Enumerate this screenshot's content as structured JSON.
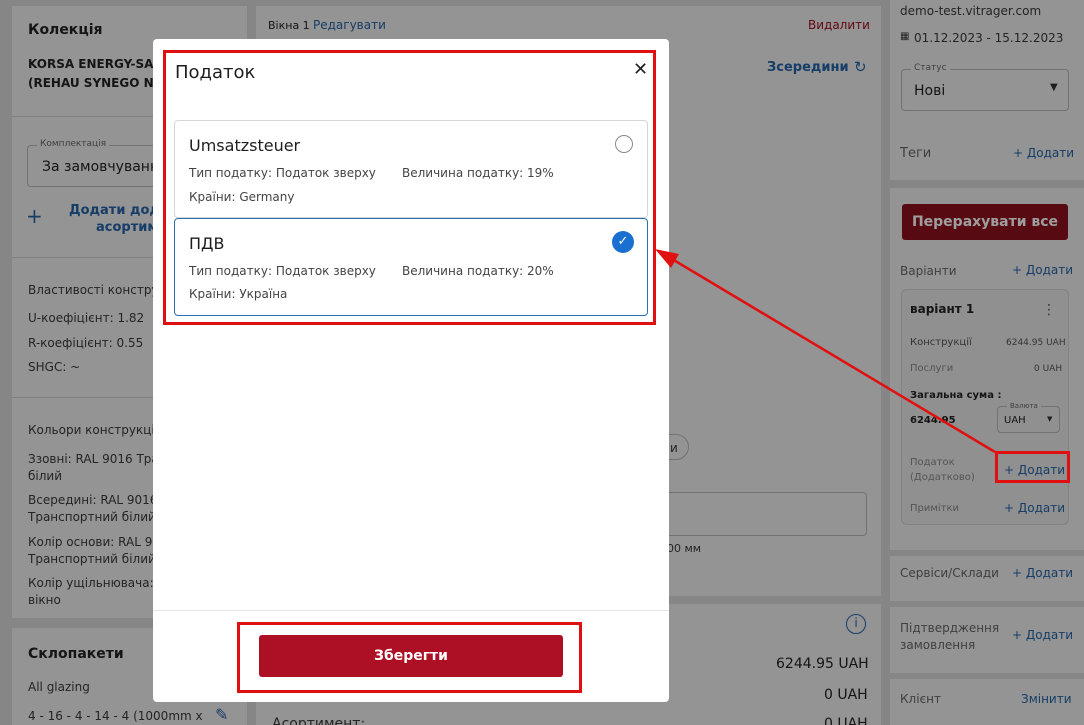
{
  "left": {
    "collection_title": "Колекція",
    "collection_line1": "KORSA ENERGY-SA",
    "collection_line2": "(REHAU SYNEGO N",
    "kit_label": "Комплектація",
    "kit_value": "За замовчуванн",
    "add_line1": "Додати дод",
    "add_line2": "асортим",
    "props_title": "Властивості констру",
    "u_coef": "U-коефіцієнт: 1.82",
    "r_coef": "R-коефіцієнт: 0.55",
    "shgc": "SHGC: ~",
    "colors_title": "Кольори конструкції",
    "c1a": "Ззовні: RAL 9016 Тран",
    "c1b": "білий",
    "c2a": "Всередині: RAL 9016",
    "c2b": "Транспортний білий",
    "c3a": "Колір основи: RAL 90",
    "c3b": "Транспортний білий",
    "c4a": "Колір ущільнювача: R",
    "c4b": "вікно",
    "glazing_title": "Склопакети",
    "glazing_sub": "All glazing",
    "glazing_spec": "4 - 16 - 4 - 14 - 4 (1000mm x"
  },
  "center": {
    "window_label": "Вікна 1",
    "edit_link": "Редагувати",
    "delete_link": "Видалити",
    "inside_label": "Зсередини",
    "dim_fragment": "00 мм",
    "chip_fragment": "и",
    "totals": [
      "6244.95 UAH",
      "0 UAH",
      "0 UAH"
    ],
    "assortment_label": "Асортимент:"
  },
  "right": {
    "domain": "demo-test.vitrager.com",
    "dates": "01.12.2023 - 15.12.2023",
    "status_label": "Статус",
    "status_value": "Нові",
    "tags_label": "Теги",
    "add": "+ Додати",
    "recalc_button": "Перерахувати все",
    "variants_label": "Варіанти",
    "variant": {
      "name": "варіант 1",
      "constructions_label": "Конструкції",
      "constructions_value": "6244.95 UAH",
      "services_label": "Послуги",
      "services_value": "0 UAH",
      "total_label": "Загальна сума :",
      "total_value": "6244.95",
      "currency_label": "Валюта",
      "currency_value": "UAH",
      "tax_label_1": "Податок",
      "tax_label_2": "(Додатково)",
      "tax_add": "+ Додати",
      "notes_label": "Примітки",
      "notes_add": "+ Додати"
    },
    "services_warehouses_label": "Сервіси/Склади",
    "order_confirmation_1": "Підтвердження",
    "order_confirmation_2": "замовлення",
    "client_label": "Клієнт",
    "change_link": "Змінити"
  },
  "modal": {
    "title": "Податок",
    "taxes": [
      {
        "name": "Umsatzsteuer",
        "type": "Тип податку: Податок зверху",
        "rate": "Величина податку: 19%",
        "countries": "Країни: Germany",
        "selected": false
      },
      {
        "name": "ПДВ",
        "type": "Тип податку: Податок зверху",
        "rate": "Величина податку: 20%",
        "countries": "Країни: Україна",
        "selected": true
      }
    ],
    "save_button": "Зберегти"
  },
  "colors": {
    "accent_blue": "#2563a6",
    "primary_red": "#ad1025",
    "highlight_red": "#e01010",
    "check_blue": "#1b6fd0"
  }
}
